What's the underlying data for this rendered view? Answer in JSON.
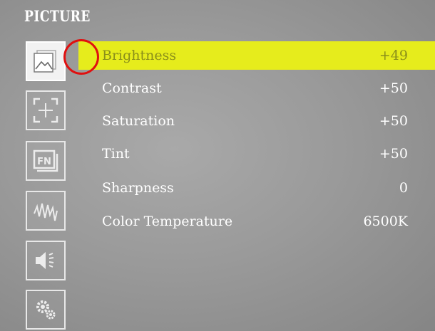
{
  "title": "PICTURE",
  "sidebar": {
    "icons": [
      {
        "name": "picture-icon",
        "active": true
      },
      {
        "name": "aspect-frame-icon",
        "active": false
      },
      {
        "name": "function-icon",
        "active": false,
        "text": "FN"
      },
      {
        "name": "waveform-icon",
        "active": false
      },
      {
        "name": "audio-icon",
        "active": false
      },
      {
        "name": "gear-icon",
        "active": false
      }
    ]
  },
  "menu": {
    "items": [
      {
        "label": "Brightness",
        "value": "+49",
        "selected": true
      },
      {
        "label": "Contrast",
        "value": "+50",
        "selected": false
      },
      {
        "label": "Saturation",
        "value": "+50",
        "selected": false
      },
      {
        "label": "Tint",
        "value": "+50",
        "selected": false
      },
      {
        "label": "Sharpness",
        "value": "0",
        "selected": false
      },
      {
        "label": "Color Temperature",
        "value": "6500K",
        "selected": false
      }
    ]
  },
  "colors": {
    "highlight": "#e6ec1c",
    "marker": "#e01010"
  }
}
